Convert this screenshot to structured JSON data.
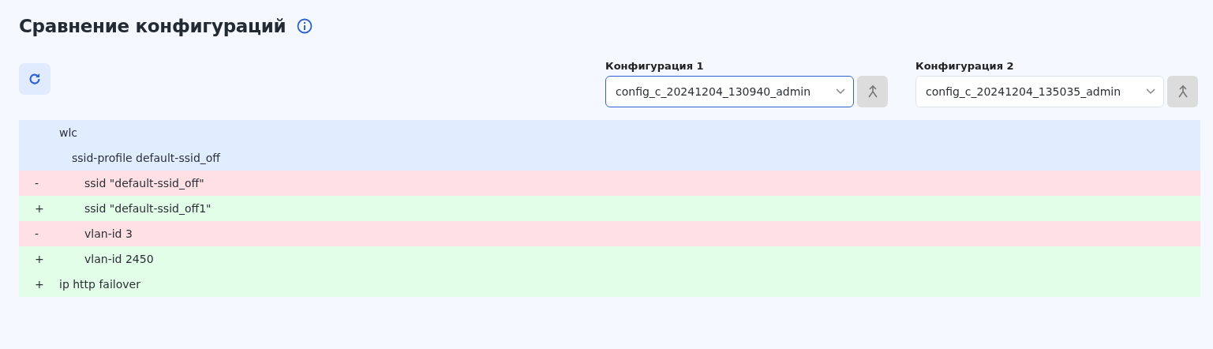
{
  "title": "Сравнение конфигураций",
  "configs": [
    {
      "label": "Конфигурация 1",
      "value": "config_c_20241204_130940_admin",
      "focused": true,
      "action_disabled": true
    },
    {
      "label": "Конфигурация 2",
      "value": "config_c_20241204_135035_admin",
      "focused": false,
      "action_disabled": true
    }
  ],
  "diff": [
    {
      "kind": "context",
      "text": "wlc",
      "children": [
        {
          "kind": "context",
          "text": "ssid-profile default-ssid_off",
          "children": [
            {
              "kind": "removed",
              "marker": "-",
              "text": "ssid \"default-ssid_off\""
            },
            {
              "kind": "added",
              "marker": "+",
              "text": "ssid \"default-ssid_off1\""
            },
            {
              "kind": "removed",
              "marker": "-",
              "text": "vlan-id 3"
            },
            {
              "kind": "added",
              "marker": "+",
              "text": "vlan-id 2450"
            }
          ]
        }
      ]
    },
    {
      "kind": "added",
      "marker": "+",
      "text": "ip http failover"
    }
  ]
}
